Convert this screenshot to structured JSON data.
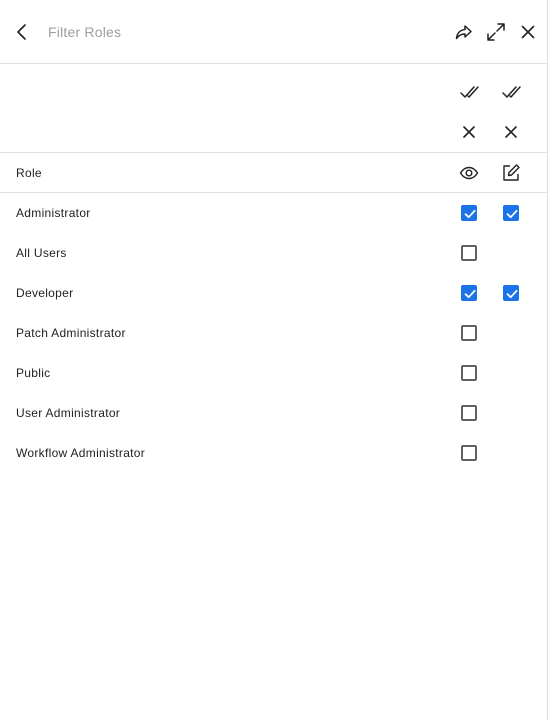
{
  "header": {
    "title": "Filter Roles",
    "icons": [
      "chevron-left-icon",
      "share-icon",
      "expand-icon",
      "close-icon"
    ]
  },
  "bulk_actions": {
    "icons": [
      "select-all-icon",
      "clear-all-icon"
    ]
  },
  "columns": {
    "role_label": "Role",
    "icons": [
      "eye-icon",
      "edit-icon"
    ]
  },
  "roles": [
    {
      "name": "Administrator",
      "read": true,
      "write": true,
      "has_write": true
    },
    {
      "name": "All Users",
      "read": false,
      "write": false,
      "has_write": false
    },
    {
      "name": "Developer",
      "read": true,
      "write": true,
      "has_write": true
    },
    {
      "name": "Patch Administrator",
      "read": false,
      "write": false,
      "has_write": false
    },
    {
      "name": "Public",
      "read": false,
      "write": false,
      "has_write": false
    },
    {
      "name": "User Administrator",
      "read": false,
      "write": false,
      "has_write": false
    },
    {
      "name": "Workflow Administrator",
      "read": false,
      "write": false,
      "has_write": false
    }
  ],
  "colors": {
    "accent": "#1a73e8",
    "border": "#e0e0e0",
    "muted": "#9e9e9e"
  }
}
